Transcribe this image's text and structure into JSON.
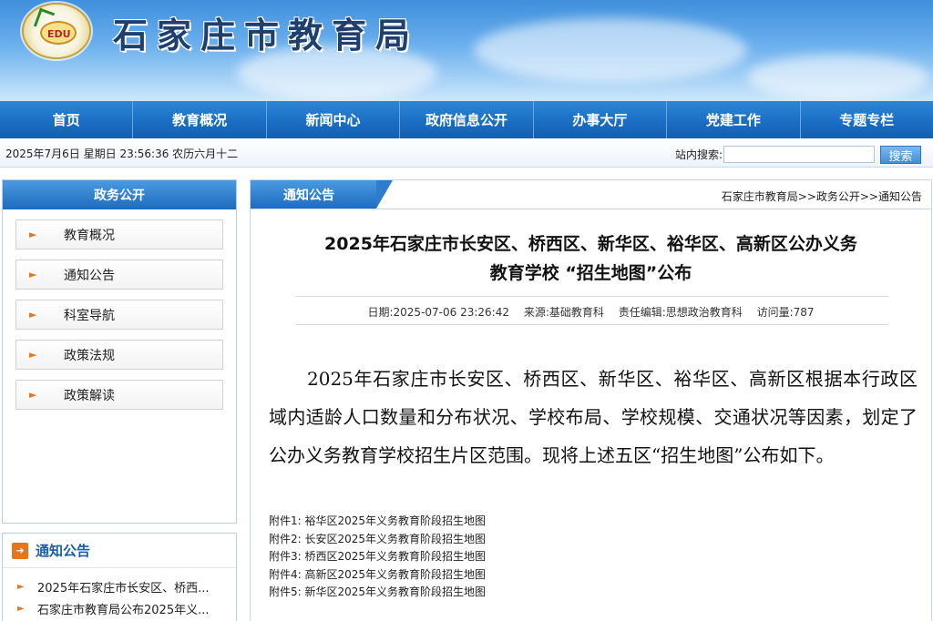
{
  "header": {
    "site_title": "石家庄市教育局",
    "logo_text": "EDU"
  },
  "nav": [
    {
      "label": "首页"
    },
    {
      "label": "教育概况"
    },
    {
      "label": "新闻中心"
    },
    {
      "label": "政府信息公开"
    },
    {
      "label": "办事大厅"
    },
    {
      "label": "党建工作"
    },
    {
      "label": "专题专栏"
    }
  ],
  "infobar": {
    "datetime": "2025年7月6日 星期日 23:56:36 农历六月十二",
    "search_label": "站内搜索:",
    "search_value": "",
    "search_button": "搜索"
  },
  "sidebar": {
    "title": "政务公开",
    "items": [
      {
        "label": "教育概况"
      },
      {
        "label": "通知公告"
      },
      {
        "label": "科室导航"
      },
      {
        "label": "政策法规"
      },
      {
        "label": "政策解读"
      }
    ]
  },
  "notices": {
    "title": "通知公告",
    "items": [
      {
        "label": "2025年石家庄市长安区、桥西..."
      },
      {
        "label": "石家庄市教育局公布2025年义..."
      }
    ]
  },
  "main": {
    "tab_label": "通知公告",
    "breadcrumb": "石家庄市教育局>>政务公开>>通知公告",
    "title_line1": "2025年石家庄市长安区、桥西区、新华区、裕华区、高新区公办义务",
    "title_line2": "教育学校 “招生地图”公布",
    "meta": {
      "date": "日期:2025-07-06 23:26:42",
      "source": "来源:基础教育科",
      "editor": "责任编辑:思想政治教育科",
      "visits": "访问量:787"
    },
    "body": "2025年石家庄市长安区、桥西区、新华区、裕华区、高新区根据本行政区域内适龄人口数量和分布状况、学校布局、学校规模、交通状况等因素，划定了公办义务教育学校招生片区范围。现将上述五区“招生地图”公布如下。",
    "attachments": [
      {
        "label": "附件1: 裕华区2025年义务教育阶段招生地图"
      },
      {
        "label": "附件2: 长安区2025年义务教育阶段招生地图"
      },
      {
        "label": "附件3: 桥西区2025年义务教育阶段招生地图"
      },
      {
        "label": "附件4: 高新区2025年义务教育阶段招生地图"
      },
      {
        "label": "附件5: 新华区2025年义务教育阶段招生地图"
      }
    ]
  }
}
